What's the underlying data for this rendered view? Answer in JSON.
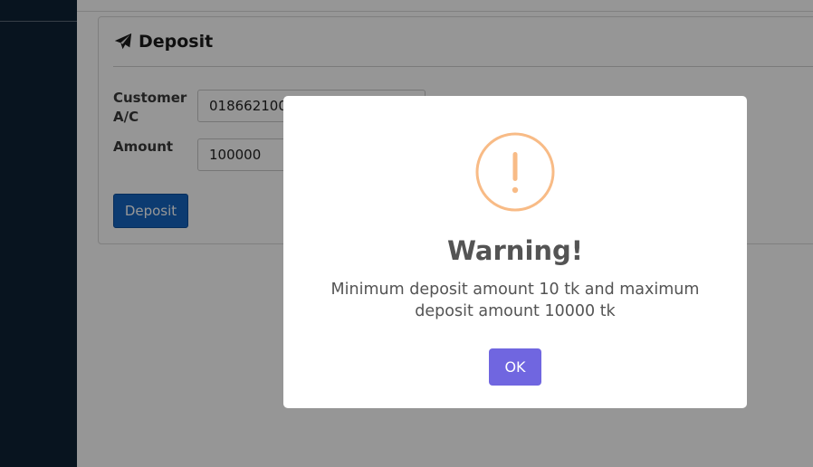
{
  "form": {
    "title": "Deposit",
    "title_icon": "paper-plane-icon",
    "customer_label": "Customer A/C",
    "customer_value": "018662100",
    "amount_label": "Amount",
    "amount_value": "100000",
    "submit_label": "Deposit"
  },
  "dialog": {
    "icon": "warning-exclamation-icon",
    "title": "Warning!",
    "message": "Minimum deposit amount 10 tk and maximum deposit amount 10000 tk",
    "ok_label": "OK"
  },
  "colors": {
    "sidebar": "#0f2236",
    "primary_button": "#1565c0",
    "ok_button": "#7066e0",
    "warning_icon": "#f8bb86"
  }
}
